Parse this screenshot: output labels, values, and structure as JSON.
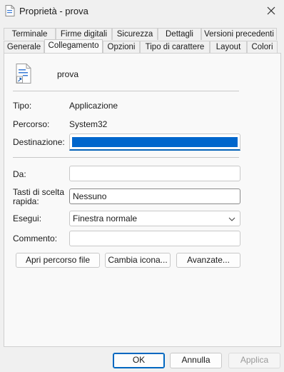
{
  "window": {
    "title": "Proprietà - prova",
    "icon": "document-icon",
    "close_icon": "close-icon"
  },
  "tabs_row1": [
    "Terminale",
    "Firme digitali",
    "Sicurezza",
    "Dettagli",
    "Versioni precedenti"
  ],
  "tabs_row2": [
    "Generale",
    "Collegamento",
    "Opzioni",
    "Tipo di carattere",
    "Layout",
    "Colori"
  ],
  "active_tab": "Collegamento",
  "shortcut": {
    "name": "prova",
    "type_label": "Tipo:",
    "type_value": "Applicazione",
    "path_label": "Percorso:",
    "path_value": "System32",
    "dest_label": "Destinazione:",
    "dest_value": "",
    "start_label": "Da:",
    "start_value": "",
    "hotkey_label": "Tasti di scelta rapida:",
    "hotkey_value": "Nessuno",
    "run_label": "Esegui:",
    "run_value": "Finestra normale",
    "comment_label": "Commento:",
    "comment_value": ""
  },
  "buttons": {
    "open_path": "Apri percorso file",
    "change_icon": "Cambia icona...",
    "advanced": "Avanzate..."
  },
  "footer": {
    "ok": "OK",
    "cancel": "Annulla",
    "apply": "Applica"
  },
  "colors": {
    "accent": "#0067c0",
    "selection": "#0066cc"
  }
}
